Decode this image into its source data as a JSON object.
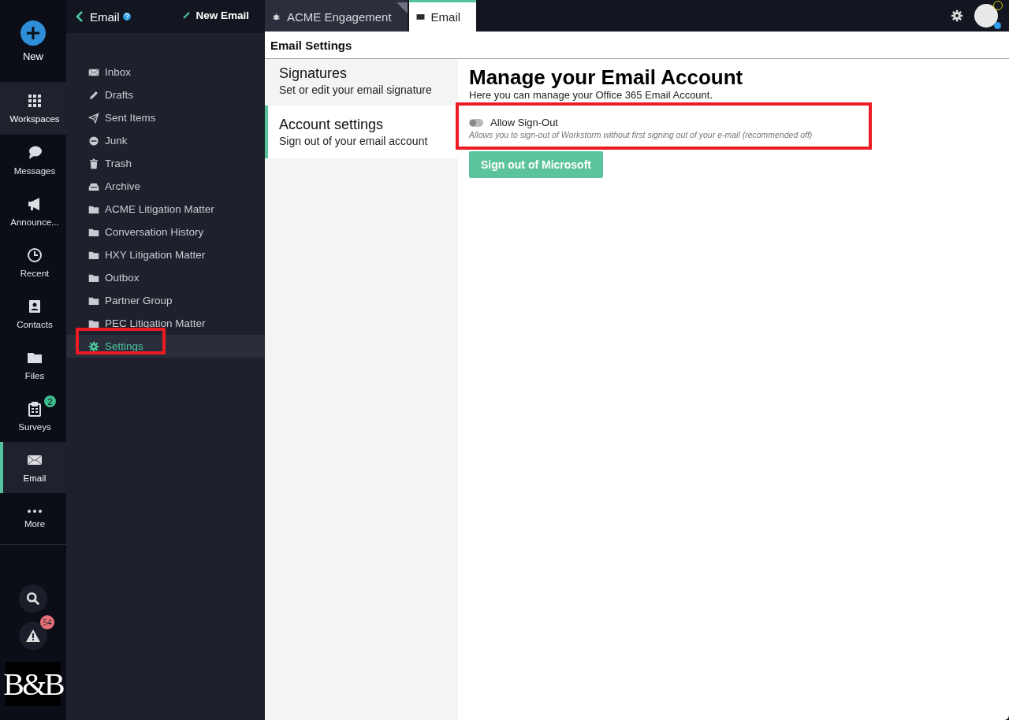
{
  "rail": {
    "new_label": "New",
    "items": [
      {
        "label": "Workspaces",
        "selected": false,
        "hovered": true
      },
      {
        "label": "Messages",
        "selected": false,
        "hovered": false
      },
      {
        "label": "Announce...",
        "selected": false,
        "hovered": false
      },
      {
        "label": "Recent",
        "selected": false,
        "hovered": false
      },
      {
        "label": "Contacts",
        "selected": false,
        "hovered": false
      },
      {
        "label": "Files",
        "selected": false,
        "hovered": false
      },
      {
        "label": "Surveys",
        "selected": false,
        "hovered": false,
        "badge": "2"
      },
      {
        "label": "Email",
        "selected": true,
        "hovered": false
      },
      {
        "label": "More",
        "selected": false,
        "hovered": false
      }
    ],
    "alerts_badge": "54",
    "logo": "B&B"
  },
  "folders": {
    "title": "Email",
    "new_email": "New Email",
    "items": [
      {
        "label": "Inbox",
        "selected": false
      },
      {
        "label": "Drafts",
        "selected": false
      },
      {
        "label": "Sent Items",
        "selected": false
      },
      {
        "label": "Junk",
        "selected": false
      },
      {
        "label": "Trash",
        "selected": false
      },
      {
        "label": "Archive",
        "selected": false
      },
      {
        "label": "ACME Litigation Matter",
        "selected": false
      },
      {
        "label": "Conversation History",
        "selected": false
      },
      {
        "label": "HXY Litigation Matter",
        "selected": false
      },
      {
        "label": "Outbox",
        "selected": false
      },
      {
        "label": "Partner Group",
        "selected": false
      },
      {
        "label": "PEC Litigation Matter",
        "selected": false
      },
      {
        "label": "Settings",
        "selected": true
      }
    ]
  },
  "tabs": [
    {
      "label": "ACME Engagement",
      "selected": false
    },
    {
      "label": "Email",
      "selected": true
    }
  ],
  "settings": {
    "title": "Email Settings",
    "sections": [
      {
        "title": "Signatures",
        "subtitle": "Set or edit your email signature",
        "selected": false
      },
      {
        "title": "Account settings",
        "subtitle": "Sign out of your email account",
        "selected": true
      }
    ],
    "heading": "Manage your Email Account",
    "intro": "Here you can manage your Office 365 Email Account.",
    "toggle": {
      "label": "Allow Sign-Out",
      "on": false,
      "description": "Allows you to sign-out of Workstorm without first signing out of your e-mail (recommended off)"
    },
    "button": "Sign out of Microsoft"
  }
}
